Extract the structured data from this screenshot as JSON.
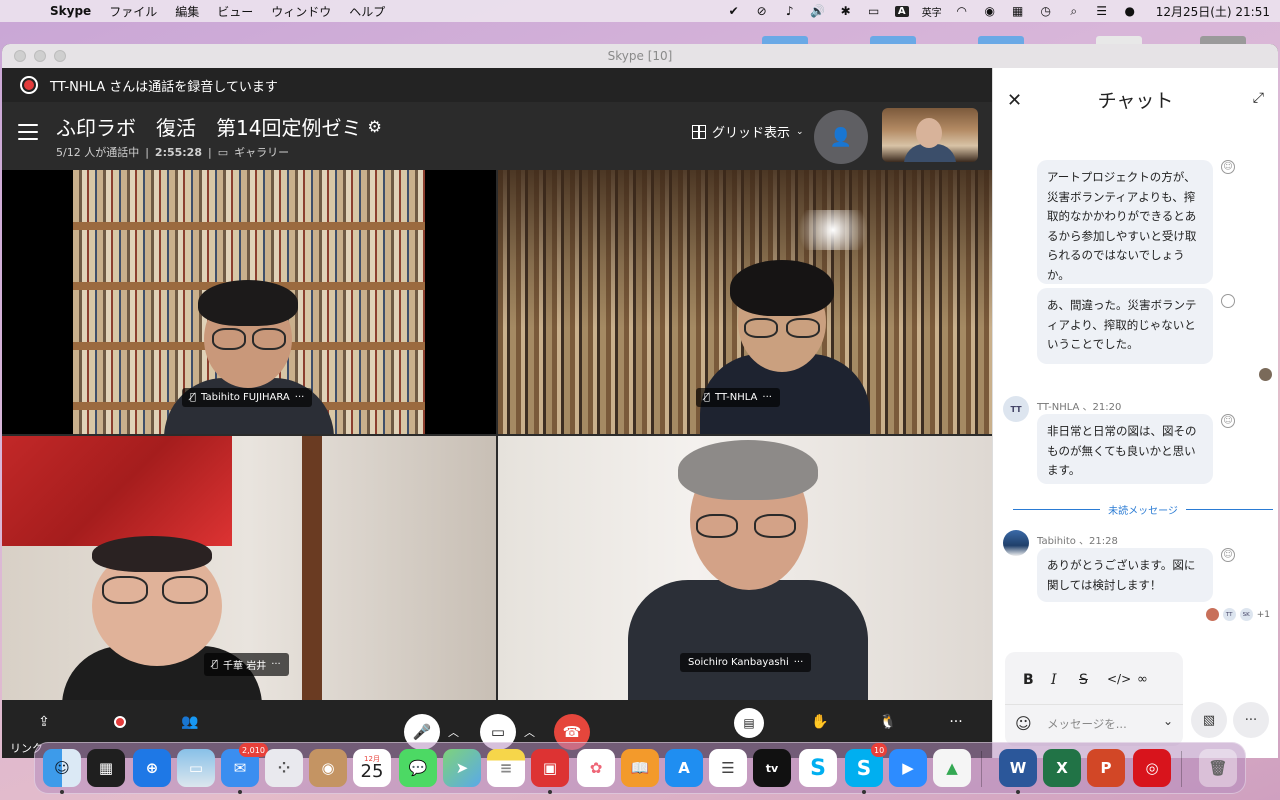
{
  "menubar": {
    "app_name": "Skype",
    "menus": [
      "ファイル",
      "編集",
      "ビュー",
      "ウィンドウ",
      "ヘルプ"
    ],
    "ime_label": "英字",
    "datetime": "12月25日(土)  21:51"
  },
  "window": {
    "title": "Skype [10]"
  },
  "recording": {
    "text": "TT-NHLA さんは通話を録音しています"
  },
  "call": {
    "name": "ふ印ラボ　復活　第14回定例ゼミ",
    "participants": "5/12 人が通話中",
    "duration": "2:55:28",
    "view_mode": "ギャラリー",
    "layout_button": "グリッド表示"
  },
  "tiles": [
    {
      "name": "Tabihito FUJIHARA",
      "muted": true
    },
    {
      "name": "TT-NHLA",
      "muted": true
    },
    {
      "name": "千華 岩井",
      "muted": true
    },
    {
      "name": "Soichiro Kanbayashi",
      "muted": false
    }
  ],
  "toolbar": {
    "share_label": "リンク"
  },
  "chat": {
    "title": "チャット",
    "messages": [
      {
        "text": "アートプロジェクトの方が、災害ボランティアよりも、搾取的なかかわりができるとあるから参加しやすいと受け取られるのではないでしょうか。"
      },
      {
        "text": "あ、間違った。災害ボランティアより、搾取的じゃないということでした。"
      },
      {
        "sender": "TT-NHLA 、21:20",
        "avatar": "TT",
        "text": "非日常と日常の図は、図そのものが無くても良いかと思います。"
      },
      {
        "sender": "Tabihito 、21:28",
        "text": "ありがとうございます。図に関しては検討します！"
      }
    ],
    "unread_label": "未読メッセージ",
    "read_receipts": [
      "TT",
      "SK"
    ],
    "read_extra": "+1",
    "input_placeholder": "メッセージを..."
  },
  "dock": {
    "calendar_month": "12月",
    "calendar_day": "25",
    "mail_badge": "2,010",
    "skype_badge": "10",
    "tv_label": "tv"
  },
  "colors": {
    "record_red": "#e23b3b",
    "end_call_red": "#e5463c",
    "unread_blue": "#2a7bd4",
    "chat_bubble": "#eef1f6"
  }
}
